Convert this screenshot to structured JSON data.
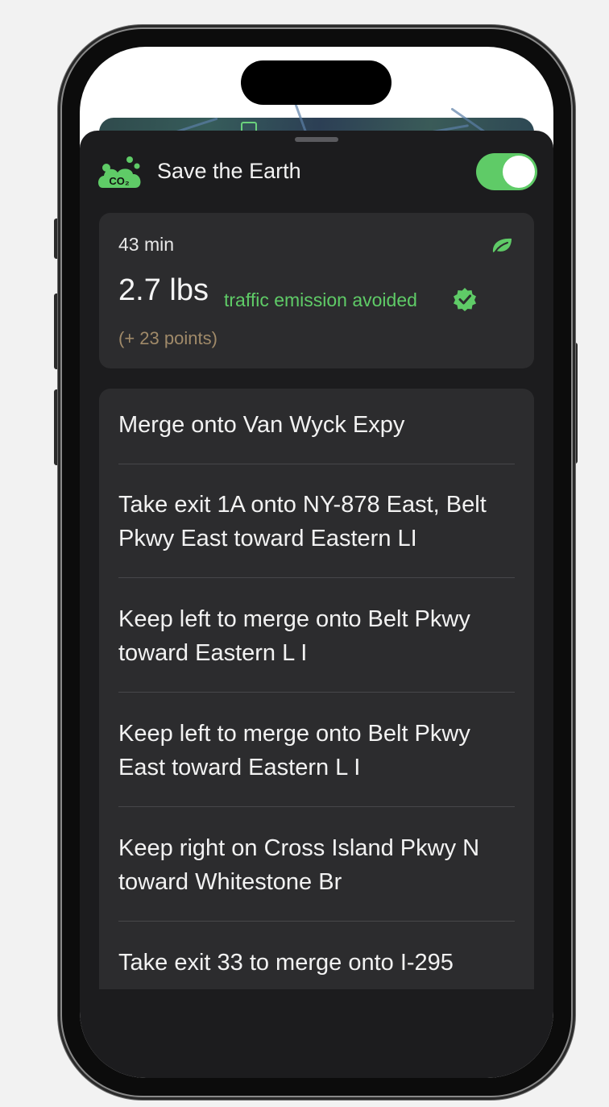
{
  "header": {
    "title": "Save the Earth",
    "badge_text": "CO₂",
    "toggle_on": true
  },
  "summary": {
    "duration": "43 min",
    "weight": "2.7 lbs",
    "emission_label": "traffic emission avoided",
    "points": "(+ 23 points)"
  },
  "directions": [
    {
      "text": "Merge onto Van Wyck Expy"
    },
    {
      "text": "Take exit 1A onto NY-878 East, Belt Pkwy East toward Eastern LI"
    },
    {
      "text": "Keep left to merge onto Belt Pkwy toward Eastern L I"
    },
    {
      "text": "Keep left to merge onto Belt Pkwy East toward Eastern L I"
    },
    {
      "text": "Keep right on Cross Island Pkwy N toward Whitestone Br"
    },
    {
      "text": "Take exit 33 to merge onto I-295"
    }
  ],
  "icons": {
    "badge": "co2-cloud-icon",
    "leaf": "leaf-icon",
    "verified": "verified-check-icon"
  },
  "colors": {
    "accent_green": "#5fcb67",
    "points_tan": "#a08a69",
    "sheet_bg": "#1c1c1e",
    "card_bg": "#2c2c2e"
  }
}
